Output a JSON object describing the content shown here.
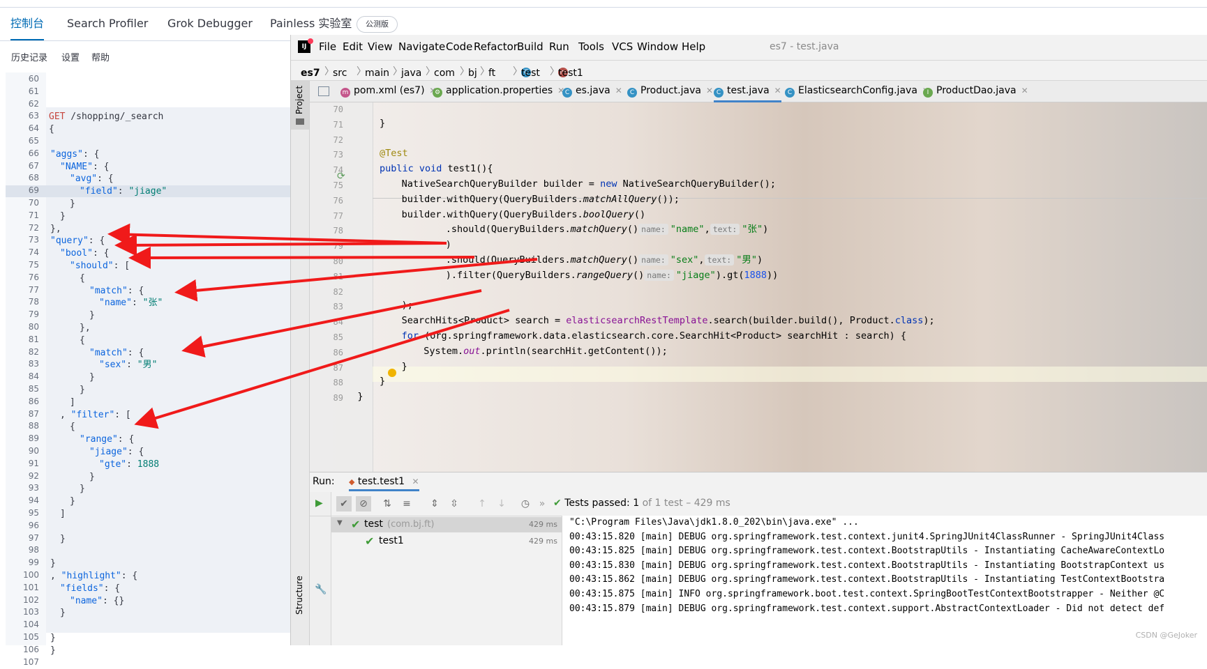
{
  "kibana": {
    "tabs": [
      "控制台",
      "Search Profiler",
      "Grok Debugger",
      "Painless 实验室"
    ],
    "badge": "公测版",
    "menu": [
      "历史记录",
      "设置",
      "帮助"
    ],
    "lines": [
      {
        "n": "60",
        "t": ""
      },
      {
        "n": "61",
        "t": ""
      },
      {
        "n": "62",
        "t": ""
      },
      {
        "n": "63",
        "verb": "GET",
        "t": " /shopping/_search"
      },
      {
        "n": "64",
        "t": "{"
      },
      {
        "n": "65",
        "t": ""
      },
      {
        "n": "66",
        "key": "\"aggs\"",
        "t": ": {"
      },
      {
        "n": "67",
        "key": "\"NAME\"",
        "t": ": {",
        "i": 1
      },
      {
        "n": "68",
        "key": "\"avg\"",
        "t": ": {",
        "i": 2
      },
      {
        "n": "69",
        "key": "\"field\"",
        "t": ": ",
        "str": "\"jiage\"",
        "i": 3
      },
      {
        "n": "70",
        "t": "}",
        "i": 2
      },
      {
        "n": "71",
        "t": "}",
        "i": 1
      },
      {
        "n": "72",
        "t": "},"
      },
      {
        "n": "73",
        "key": "\"query\"",
        "t": ": {"
      },
      {
        "n": "74",
        "key": "\"bool\"",
        "t": ": {",
        "i": 1
      },
      {
        "n": "75",
        "key": "\"should\"",
        "t": ": [",
        "i": 2
      },
      {
        "n": "76",
        "t": "{",
        "i": 3
      },
      {
        "n": "77",
        "key": "\"match\"",
        "t": ": {",
        "i": 4
      },
      {
        "n": "78",
        "key": "\"name\"",
        "t": ": ",
        "str": "\"张\"",
        "i": 5
      },
      {
        "n": "79",
        "t": "}",
        "i": 4
      },
      {
        "n": "80",
        "t": "},",
        "i": 3
      },
      {
        "n": "81",
        "t": "{",
        "i": 3
      },
      {
        "n": "82",
        "key": "\"match\"",
        "t": ": {",
        "i": 4
      },
      {
        "n": "83",
        "key": "\"sex\"",
        "t": ": ",
        "str": "\"男\"",
        "i": 5
      },
      {
        "n": "84",
        "t": "}",
        "i": 4
      },
      {
        "n": "85",
        "t": "}",
        "i": 3
      },
      {
        "n": "86",
        "t": "]",
        "i": 2
      },
      {
        "n": "87",
        "t": ", ",
        "key2": "\"filter\"",
        "t2": ": [",
        "i": 1
      },
      {
        "n": "88",
        "t": "{",
        "i": 2
      },
      {
        "n": "89",
        "key": "\"range\"",
        "t": ": {",
        "i": 3
      },
      {
        "n": "90",
        "key": "\"jiage\"",
        "t": ": {",
        "i": 4
      },
      {
        "n": "91",
        "key": "\"gte\"",
        "t": ": ",
        "num": "1888",
        "i": 5
      },
      {
        "n": "92",
        "t": "}",
        "i": 4
      },
      {
        "n": "93",
        "t": "}",
        "i": 3
      },
      {
        "n": "94",
        "t": "}",
        "i": 2
      },
      {
        "n": "95",
        "t": "]",
        "i": 1
      },
      {
        "n": "96",
        "t": ""
      },
      {
        "n": "97",
        "t": "}",
        "i": 1
      },
      {
        "n": "98",
        "t": ""
      },
      {
        "n": "99",
        "t": "}"
      },
      {
        "n": "100",
        "t": ", ",
        "key2": "\"highlight\"",
        "t2": ": {"
      },
      {
        "n": "101",
        "key": "\"fields\"",
        "t": ": {",
        "i": 1
      },
      {
        "n": "102",
        "key": "\"name\"",
        "t": ": {}",
        "i": 2
      },
      {
        "n": "103",
        "t": "}",
        "i": 1
      },
      {
        "n": "104",
        "t": ""
      },
      {
        "n": "105",
        "t": "}"
      },
      {
        "n": "106",
        "t": "}"
      },
      {
        "n": "107",
        "t": ""
      }
    ]
  },
  "ij": {
    "menu": [
      "File",
      "Edit",
      "View",
      "Navigate",
      "Code",
      "Refactor",
      "Build",
      "Run",
      "Tools",
      "VCS",
      "Window",
      "Help"
    ],
    "title": "es7 - test.java",
    "crumbs": [
      "es7",
      "src",
      "main",
      "java",
      "com",
      "bj",
      "ft",
      "test",
      "test1"
    ],
    "side_project": "Project",
    "side_structure": "Structure",
    "tabs": [
      "pom.xml (es7)",
      "application.properties",
      "es.java",
      "Product.java",
      "test.java",
      "ElasticsearchConfig.java",
      "ProductDao.java"
    ],
    "code_line_numbers": [
      "70",
      "71",
      "72",
      "73",
      "74",
      "75",
      "76",
      "77",
      "78",
      "79",
      "80",
      "81",
      "82",
      "83",
      "84",
      "85",
      "86",
      "87",
      "88",
      "89"
    ],
    "code": {
      "l71": "}",
      "ann": "@Test",
      "l74_kw": "public void",
      "l74": " test1(){",
      "l75a": "NativeSearchQueryBuilder builder = ",
      "new": "new",
      "l75b": " NativeSearchQueryBuilder();",
      "l76a": "builder.withQuery(QueryBuilders.",
      "matchAll": "matchAllQuery",
      "l76b": "());",
      "l77a": "builder.withQuery(QueryBuilders.",
      "boolQ": "boolQuery",
      "l77b": "()",
      "should": ".should(QueryBuilders.",
      "matchQ": "matchQuery",
      "hint_name": "name:",
      "hint_text": "text:",
      "s_name": "\"name\"",
      "s_zhang": "\"张\"",
      "s_sex": "\"sex\"",
      "s_nan": "\"男\"",
      "close": ")",
      "comma": ",",
      "l81a": ").filter(QueryBuilders.",
      "rangeQ": "rangeQuery",
      "s_jiage": "\"jiage\"",
      "gt": ").gt(",
      "n1888": "1888",
      "l81end": "))",
      "l83": ");",
      "l84a": "SearchHits<Product> search = ",
      "l84f": "elasticsearchRestTemplate",
      "l84b": ".search(builder.build(), Product.",
      "cls": "class",
      "l84c": ");",
      "for": "for",
      "l85": " (org.springframework.data.elasticsearch.core.SearchHit<Product> searchHit : search) {",
      "l86a": "System.",
      "out": "out",
      "l86b": ".println(searchHit.getContent());",
      "l87": "}",
      "l88": "}",
      "l89": "}"
    },
    "run": {
      "label": "Run:",
      "tab": "test.test1",
      "status": "Tests passed:",
      "count": "1",
      "of": "of 1 test – 429 ms",
      "tree": [
        {
          "name": "test",
          "pkg": "(com.bj.ft)",
          "time": "429 ms"
        },
        {
          "name": "test1",
          "time": "429 ms"
        }
      ],
      "console": [
        "\"C:\\Program Files\\Java\\jdk1.8.0_202\\bin\\java.exe\" ...",
        "00:43:15.820 [main] DEBUG org.springframework.test.context.junit4.SpringJUnit4ClassRunner - SpringJUnit4Class",
        "00:43:15.825 [main] DEBUG org.springframework.test.context.BootstrapUtils - Instantiating CacheAwareContextLo",
        "00:43:15.830 [main] DEBUG org.springframework.test.context.BootstrapUtils - Instantiating BootstrapContext us",
        "00:43:15.862 [main] DEBUG org.springframework.test.context.BootstrapUtils - Instantiating TestContextBootstra",
        "00:43:15.875 [main] INFO org.springframework.boot.test.context.SpringBootTestContextBootstrapper - Neither @C",
        "00:43:15.879 [main] DEBUG org.springframework.test.context.support.AbstractContextLoader - Did not detect def"
      ]
    },
    "watermark": "CSDN @GeJoker"
  }
}
